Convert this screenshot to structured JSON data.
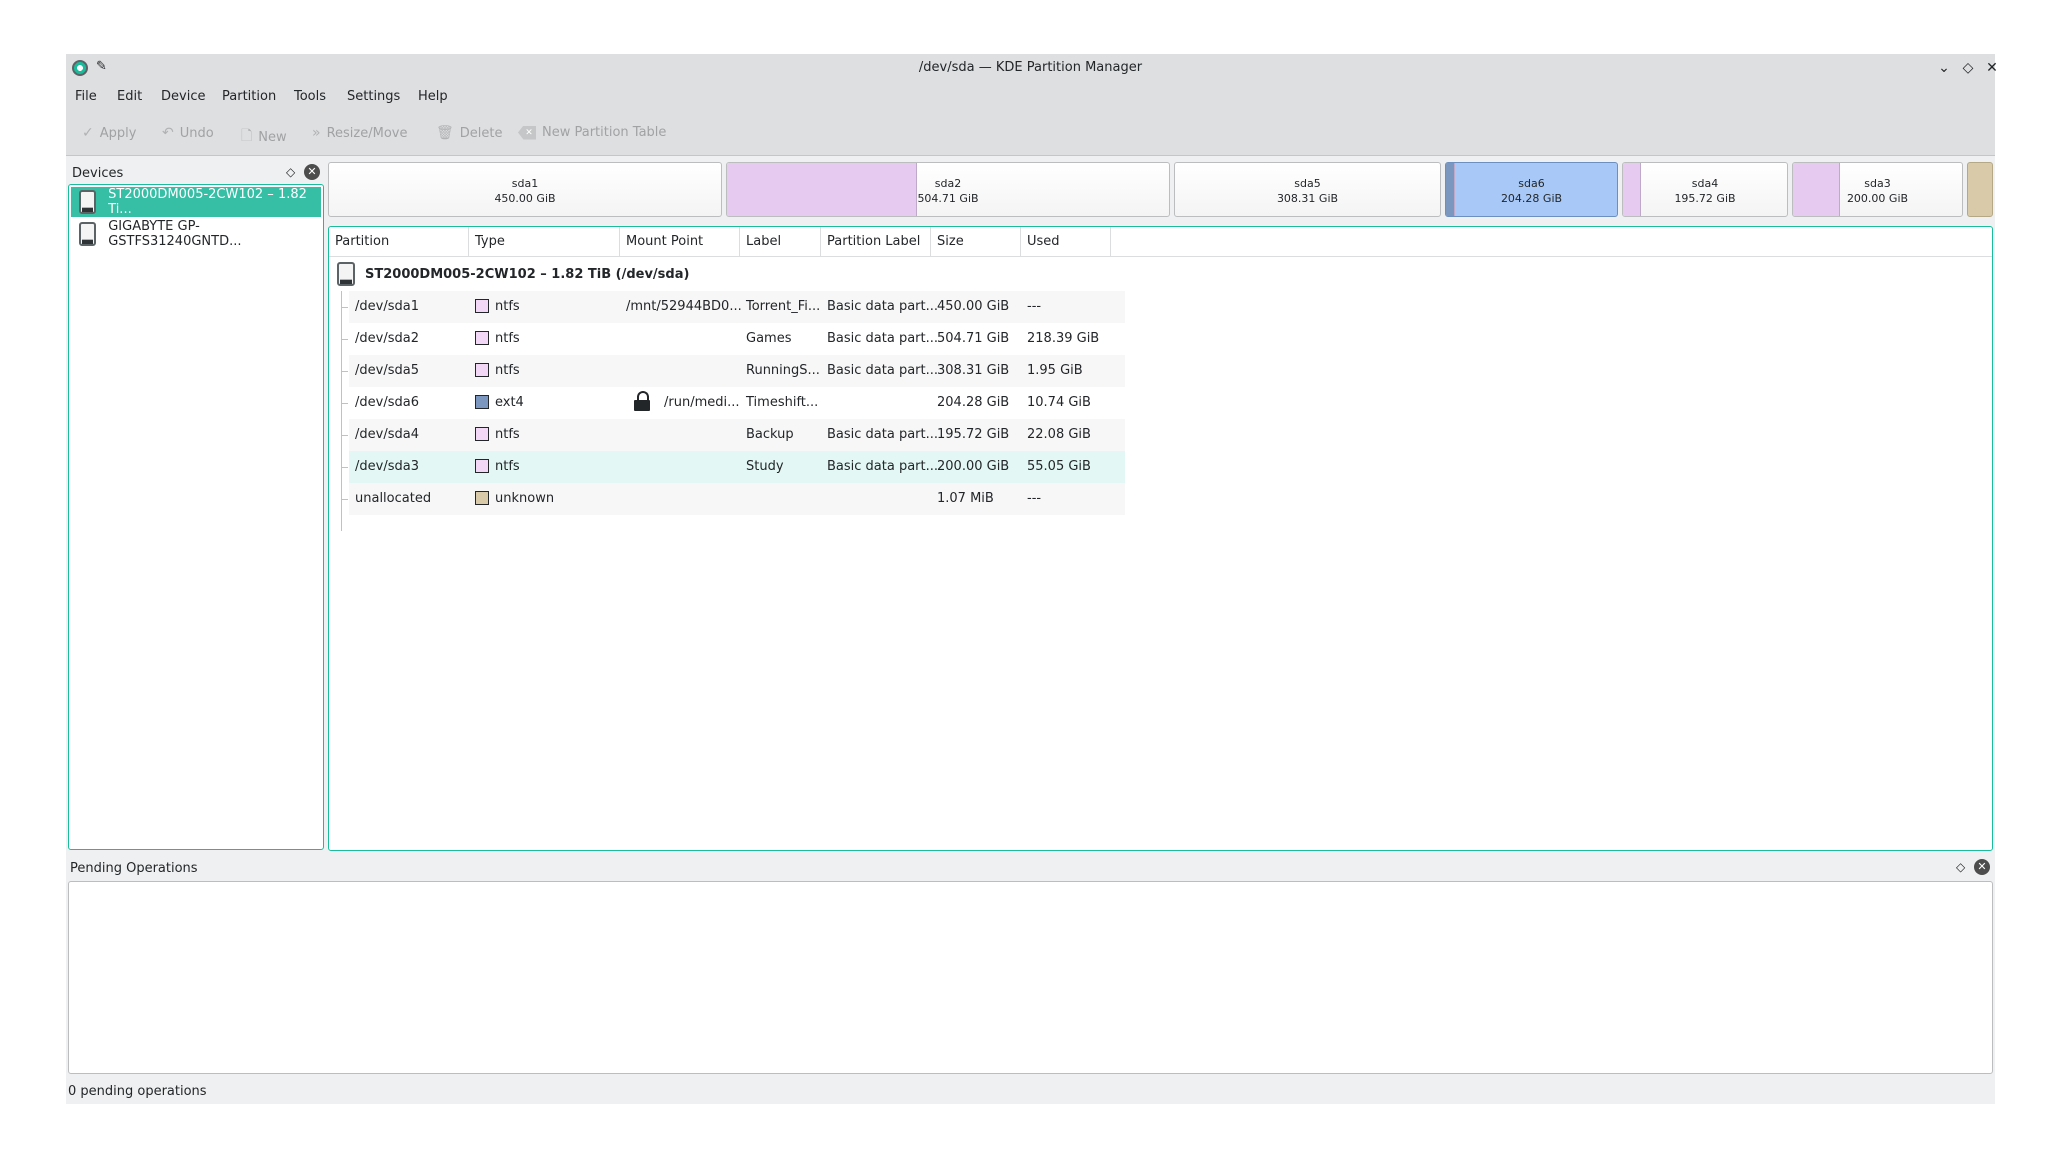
{
  "window": {
    "title": "/dev/sda — KDE Partition Manager",
    "pin_icon": "pin-icon",
    "controls": {
      "minimize": "⌄",
      "maximize": "◇",
      "close": "✕"
    }
  },
  "menu": [
    "File",
    "Edit",
    "Device",
    "Partition",
    "Tools",
    "Settings",
    "Help"
  ],
  "toolbar": {
    "apply": {
      "label": "Apply",
      "icon": "✓"
    },
    "undo": {
      "label": "Undo",
      "icon": "↶"
    },
    "new": {
      "label": "New",
      "icon": "🗋"
    },
    "resize": {
      "label": "Resize/Move",
      "icon": "»"
    },
    "delete": {
      "label": "Delete",
      "icon": "🗑"
    },
    "new_table": {
      "label": "New Partition Table",
      "icon": "✕"
    }
  },
  "devices": {
    "title": "Devices",
    "float_icon": "◇",
    "close_icon": "✕",
    "items": [
      {
        "label": "ST2000DM005-2CW102 – 1.82 Ti...",
        "selected": true
      },
      {
        "label": "GIGABYTE GP-GSTFS31240GNTD...",
        "selected": false
      }
    ]
  },
  "partition_bar": [
    {
      "name": "sda1",
      "size": "450.00 GiB",
      "used_fraction": 0.0,
      "selected": false
    },
    {
      "name": "sda2",
      "size": "504.71 GiB",
      "used_fraction": 0.43,
      "selected": false
    },
    {
      "name": "sda5",
      "size": "308.31 GiB",
      "used_fraction": 0.0,
      "selected": false
    },
    {
      "name": "sda6",
      "size": "204.28 GiB",
      "used_fraction": 0.05,
      "selected": true
    },
    {
      "name": "sda4",
      "size": "195.72 GiB",
      "used_fraction": 0.11,
      "selected": false
    },
    {
      "name": "sda3",
      "size": "200.00 GiB",
      "used_fraction": 0.28,
      "selected": false
    },
    {
      "name": "",
      "size": "",
      "used_fraction": 0.0,
      "selected": false,
      "unallocated": true
    }
  ],
  "table": {
    "columns": [
      "Partition",
      "Type",
      "Mount Point",
      "Label",
      "Partition Label",
      "Size",
      "Used"
    ],
    "disk": "ST2000DM005-2CW102 – 1.82 TiB (/dev/sda)",
    "rows": [
      {
        "partition": "/dev/sda1",
        "type": "ntfs",
        "color": "#f2d7f7",
        "mount": "/mnt/52944BD0...",
        "locked": false,
        "label": "Torrent_Fi...",
        "plabel": "Basic data part...",
        "size": "450.00 GiB",
        "used": "---"
      },
      {
        "partition": "/dev/sda2",
        "type": "ntfs",
        "color": "#f2d7f7",
        "mount": "",
        "locked": false,
        "label": "Games",
        "plabel": "Basic data part...",
        "size": "504.71 GiB",
        "used": "218.39 GiB"
      },
      {
        "partition": "/dev/sda5",
        "type": "ntfs",
        "color": "#f2d7f7",
        "mount": "",
        "locked": false,
        "label": "RunningS...",
        "plabel": "Basic data part...",
        "size": "308.31 GiB",
        "used": "1.95 GiB"
      },
      {
        "partition": "/dev/sda6",
        "type": "ext4",
        "color": "#7b96bf",
        "mount": "/run/medi...",
        "locked": true,
        "label": "Timeshift...",
        "plabel": "",
        "size": "204.28 GiB",
        "used": "10.74 GiB"
      },
      {
        "partition": "/dev/sda4",
        "type": "ntfs",
        "color": "#f2d7f7",
        "mount": "",
        "locked": false,
        "label": "Backup",
        "plabel": "Basic data part...",
        "size": "195.72 GiB",
        "used": "22.08 GiB"
      },
      {
        "partition": "/dev/sda3",
        "type": "ntfs",
        "color": "#f2d7f7",
        "mount": "",
        "locked": false,
        "label": "Study",
        "plabel": "Basic data part...",
        "size": "200.00 GiB",
        "used": "55.05 GiB"
      },
      {
        "partition": "unallocated",
        "type": "unknown",
        "color": "#d9cbaa",
        "mount": "",
        "locked": false,
        "label": "",
        "plabel": "",
        "size": "1.07 MiB",
        "used": "---"
      }
    ]
  },
  "pending": {
    "title": "Pending Operations",
    "float_icon": "◇",
    "close_icon": "✕"
  },
  "status": "0 pending operations",
  "colors": {
    "accent": "#1abc9c",
    "selection": "#37bfa6",
    "ntfs": "#e6caf0",
    "ext4": "#a8c9f7",
    "unallocated": "#d9cbaa"
  }
}
